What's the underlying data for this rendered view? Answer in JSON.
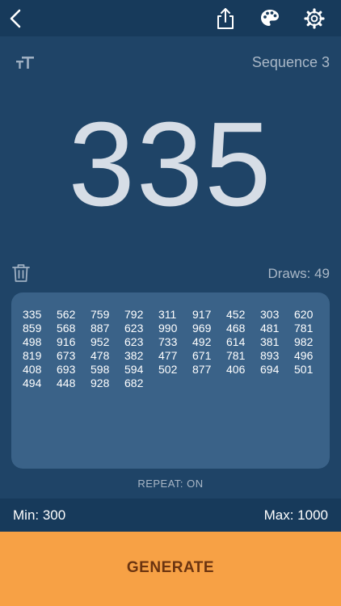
{
  "colors": {
    "background": "#1f4467",
    "top_bar": "#173a5b",
    "history_panel": "#3a6288",
    "generate_button": "#f7a145",
    "generate_text": "#6b3410",
    "big_number": "#d6dde6"
  },
  "toolbar": {
    "icons": [
      "back-chevron-icon",
      "share-icon",
      "palette-icon",
      "settings-gear-icon",
      "text-size-icon",
      "trash-icon"
    ]
  },
  "sequence_label": "Sequence 3",
  "current_number": "335",
  "draws_label": "Draws: 49",
  "history": [
    "335",
    "562",
    "759",
    "792",
    "311",
    "917",
    "452",
    "303",
    "620",
    "859",
    "568",
    "887",
    "623",
    "990",
    "969",
    "468",
    "481",
    "781",
    "498",
    "916",
    "952",
    "623",
    "733",
    "492",
    "614",
    "381",
    "982",
    "819",
    "673",
    "478",
    "382",
    "477",
    "671",
    "781",
    "893",
    "496",
    "408",
    "693",
    "598",
    "594",
    "502",
    "877",
    "406",
    "694",
    "501",
    "494",
    "448",
    "928",
    "682"
  ],
  "repeat_label": "REPEAT: ON",
  "range": {
    "min_label": "Min: 300",
    "max_label": "Max: 1000"
  },
  "generate_label": "GENERATE"
}
